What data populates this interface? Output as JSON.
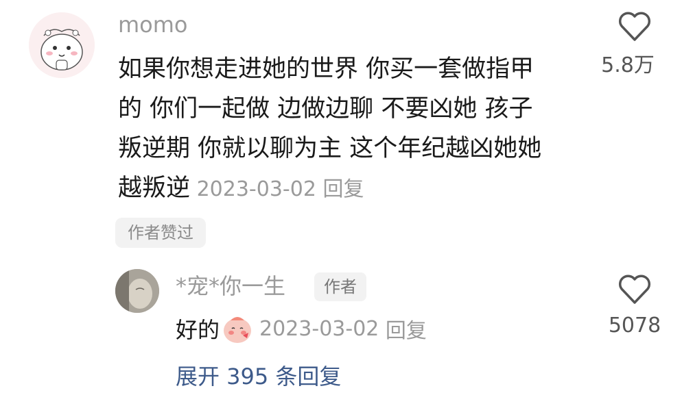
{
  "main_comment": {
    "username": "momo",
    "lines": [
      "如果你想走进她的世界 你买一套做指甲",
      "的 你们一起做 边做边聊 不要凶她 孩子",
      "叛逆期 你就以聊为主 这个年纪越凶她她",
      "越叛逆"
    ],
    "date": "2023-03-02",
    "reply_label": "回复",
    "like_count": "5.8万",
    "like_icon": "heart-outline-icon",
    "author_liked_badge": "作者赞过"
  },
  "reply": {
    "username": "*宠*你一生",
    "author_tag": "作者",
    "text": "好的",
    "emoji": "blushing-face-emoji",
    "date": "2023-03-02",
    "reply_label": "回复",
    "like_count": "5078",
    "like_icon": "heart-outline-icon"
  },
  "expand_replies": "展开 395 条回复",
  "colors": {
    "meta_gray": "#9a9a9a",
    "text": "#1a1a1a",
    "link_blue": "#3d5a8a",
    "badge_bg": "#f2f2f2"
  }
}
